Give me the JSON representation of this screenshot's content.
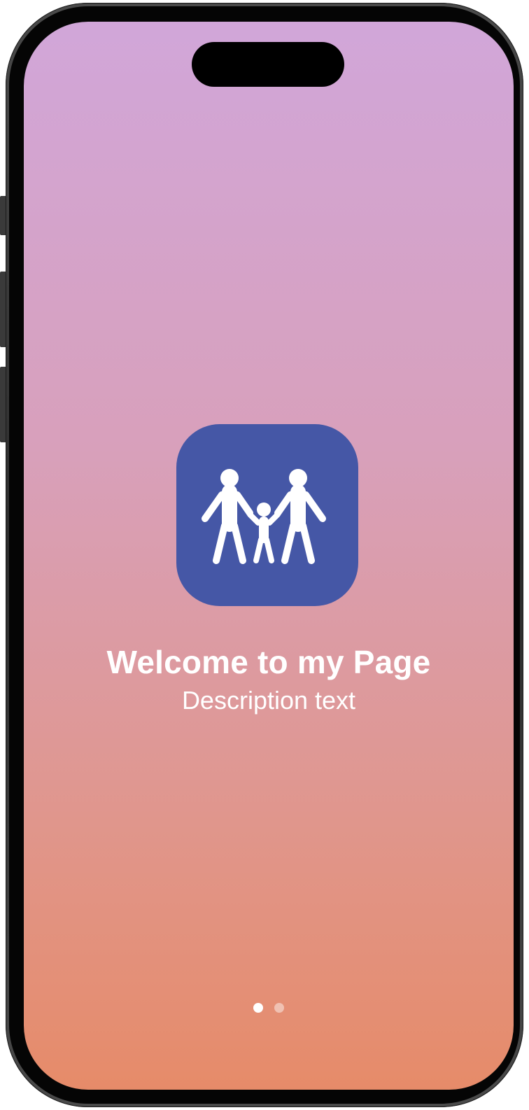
{
  "welcome": {
    "title": "Welcome to my Page",
    "description": "Description text",
    "icon": "family-icon",
    "icon_background": "#4557a6"
  },
  "pager": {
    "total_pages": 2,
    "current_page": 1
  },
  "colors": {
    "gradient_top": "#d1a6d9",
    "gradient_bottom": "#e68b69",
    "text": "#ffffff"
  }
}
